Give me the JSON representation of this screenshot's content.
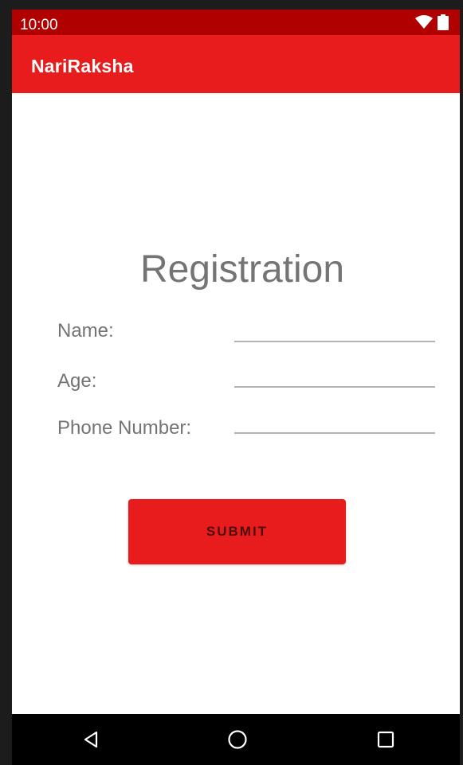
{
  "status_bar": {
    "time": "10:00",
    "icons": [
      "wifi-icon",
      "battery-icon"
    ]
  },
  "app_bar": {
    "title": "NariRaksha"
  },
  "form": {
    "title": "Registration",
    "fields": [
      {
        "label": "Name:",
        "value": ""
      },
      {
        "label": "Age:",
        "value": ""
      },
      {
        "label": "Phone Number:",
        "value": ""
      }
    ],
    "submit_label": "SUBMIT"
  },
  "nav_bar": {
    "icons": [
      "back-icon",
      "home-icon",
      "recents-icon"
    ]
  },
  "colors": {
    "status_bar": "#b00000",
    "app_bar": "#e81c1c",
    "button": "#e81c1c",
    "text_gray": "#747474"
  }
}
